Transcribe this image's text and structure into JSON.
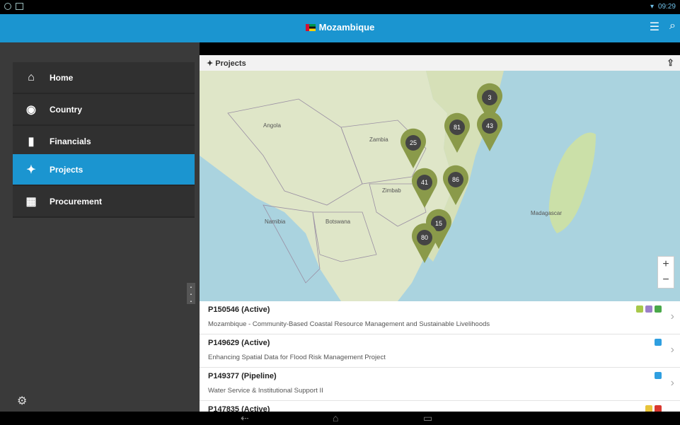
{
  "status": {
    "time": "09:29"
  },
  "app": {
    "title": "Mozambique"
  },
  "sidebar": {
    "items": [
      {
        "label": "Home",
        "icon": "home-icon"
      },
      {
        "label": "Country",
        "icon": "compass-icon"
      },
      {
        "label": "Financials",
        "icon": "bar-chart-icon"
      },
      {
        "label": "Projects",
        "icon": "pin-icon"
      },
      {
        "label": "Procurement",
        "icon": "calendar-icon"
      }
    ],
    "active": "Projects"
  },
  "panel": {
    "title": "Projects"
  },
  "map": {
    "labels": [
      "Angola",
      "Zambia",
      "Zimbab",
      "Namibia",
      "Botswana",
      "Madagascar"
    ],
    "clusters": [
      "3",
      "81",
      "43",
      "25",
      "41",
      "86",
      "15",
      "80"
    ],
    "zoom_in": "+",
    "zoom_out": "−"
  },
  "projects": [
    {
      "id": "P150546 (Active)",
      "title": "Mozambique - Community-Based Coastal Resource Management and Sustainable Livelihoods",
      "badges": [
        "#a8c84a",
        "#9b7fc9",
        "#4aa84a"
      ]
    },
    {
      "id": "P149629 (Active)",
      "title": "Enhancing Spatial Data for Flood Risk Management Project",
      "badges": [
        "#2f9fe0"
      ]
    },
    {
      "id": "P149377 (Pipeline)",
      "title": "Water Service & Institutional Support II",
      "badges": [
        "#2f9fe0"
      ]
    },
    {
      "id": "P147835 (Active)",
      "title": "",
      "badges": [
        "#e8c43a",
        "#d9382f"
      ]
    }
  ]
}
